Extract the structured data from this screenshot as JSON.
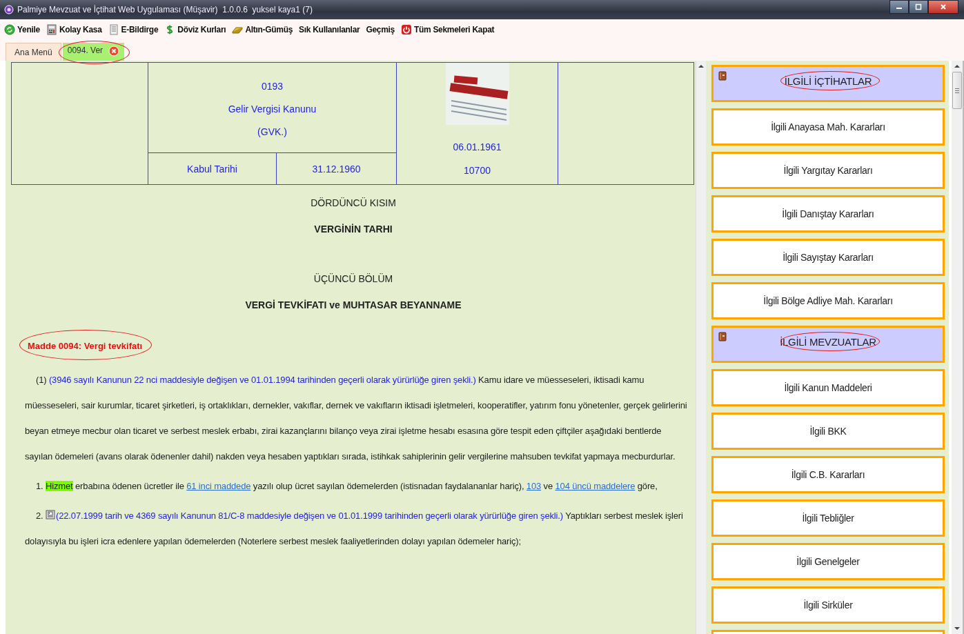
{
  "window": {
    "title": "Palmiye Mevzuat ve İçtihat Web Uygulaması (Müşavir)  1.0.0.6  yuksel kaya1 (7)"
  },
  "toolbar": [
    {
      "label": "Yenile"
    },
    {
      "label": "Kolay Kasa"
    },
    {
      "label": "E-Bildirge"
    },
    {
      "label": "Döviz Kurları"
    },
    {
      "label": "Altın-Gümüş"
    },
    {
      "label": "Sık Kullanılanlar"
    },
    {
      "label": "Geçmiş"
    },
    {
      "label": "Tüm Sekmeleri Kapat"
    }
  ],
  "tabs": [
    {
      "label": "Ana Menü",
      "selected": false,
      "closable": false,
      "circled": false
    },
    {
      "label": "0094. Ver",
      "selected": true,
      "closable": true,
      "circled": true
    }
  ],
  "law_header": {
    "number": "0193",
    "name": "Gelir Vergisi Kanunu",
    "abbreviation": "(GVK.)",
    "acceptance_label": "Kabul Tarihi",
    "acceptance_date": "31.12.1960",
    "gazette_date": "06.01.1961",
    "gazette_number": "10700"
  },
  "document": {
    "headings": [
      {
        "text": "DÖRDÜNCÜ KISIM",
        "bold": false
      },
      {
        "text": "VERGİNİN TARHI",
        "bold": true
      },
      {
        "text": "ÜÇÜNCÜ BÖLÜM",
        "bold": false
      },
      {
        "text": "VERGİ TEVKİFATI ve MUHTASAR BEYANNAME",
        "bold": true
      }
    ],
    "article_title": {
      "text": "Madde 0094: Vergi tevkifatı",
      "circled": true
    },
    "paragraphs": [
      {
        "segments": [
          {
            "kind": "text",
            "text": "(1) "
          },
          {
            "kind": "amendment",
            "text": "(3946 sayılı Kanunun 22 nci maddesiyle değişen ve 01.01.1994 tarihinden geçerli olarak yürürlüğe giren şekli.)"
          },
          {
            "kind": "text",
            "text": " Kamu idare ve müesseseleri, iktisadi kamu müesseseleri, sair kurumlar, ticaret şirketleri, iş ortaklıkları, dernekler, vakıflar, dernek ve vakıfların iktisadi işletmeleri, kooperatifler, yatırım fonu yönetenler, gerçek gelirlerini beyan etmeye mecbur olan ticaret ve serbest meslek erbabı, zirai kazançlarını bilanço veya zirai işletme hesabı esasına göre tespit eden çiftçiler aşağıdaki bentlerde sayılan ödemeleri (avans olarak ödenenler dahil) nakden veya hesaben yaptıkları sırada, istihkak sahiplerinin gelir vergilerine mahsuben tevkifat yapmaya mecburdurlar."
          }
        ]
      },
      {
        "segments": [
          {
            "kind": "text",
            "text": "1. "
          },
          {
            "kind": "highlight",
            "text": "Hizmet"
          },
          {
            "kind": "text",
            "text": " erbabına ödenen ücretler ile "
          },
          {
            "kind": "link",
            "text": "61 inci maddede"
          },
          {
            "kind": "text",
            "text": " yazılı olup ücret sayılan ödemelerden (istisnadan faydalananlar hariç), "
          },
          {
            "kind": "link",
            "text": "103"
          },
          {
            "kind": "text",
            "text": " ve "
          },
          {
            "kind": "link",
            "text": "104 üncü maddelere"
          },
          {
            "kind": "text",
            "text": " göre,"
          }
        ]
      },
      {
        "segments": [
          {
            "kind": "text",
            "text": "2. "
          },
          {
            "kind": "icon"
          },
          {
            "kind": "amendment",
            "text": "(22.07.1999 tarih ve 4369 sayılı Kanunun 81/C-8 maddesiyle değişen ve 01.01.1999 tarihinden geçerli olarak yürürlüğe giren şekli.)"
          },
          {
            "kind": "text",
            "text": " Yaptıkları serbest meslek işleri dolayısıyla bu işleri icra edenlere yapılan ödemelerden (Noterlere serbest meslek faaliyetlerinden dolayı yapılan ödemeler hariç);"
          }
        ]
      }
    ]
  },
  "side_panel": {
    "items": [
      {
        "kind": "header",
        "label": "İLGİLİ İÇTİHATLAR",
        "circled": true
      },
      {
        "kind": "link",
        "label": "İlgili Anayasa Mah. Kararları",
        "circled": false
      },
      {
        "kind": "link",
        "label": "İlgili Yargıtay Kararları",
        "circled": false
      },
      {
        "kind": "link",
        "label": "İlgili Danıştay Kararları",
        "circled": false
      },
      {
        "kind": "link",
        "label": "İlgili Sayıştay Kararları",
        "circled": false
      },
      {
        "kind": "link",
        "label": "İlgili Bölge Adliye Mah. Kararları",
        "circled": false
      },
      {
        "kind": "header",
        "label": "İLGİLİ MEVZUATLAR",
        "circled": true
      },
      {
        "kind": "link",
        "label": "İlgili Kanun Maddeleri",
        "circled": false
      },
      {
        "kind": "link",
        "label": "İlgili BKK",
        "circled": false
      },
      {
        "kind": "link",
        "label": "İlgili C.B. Kararları",
        "circled": false
      },
      {
        "kind": "link",
        "label": "İlgili Tebliğler",
        "circled": false
      },
      {
        "kind": "link",
        "label": "İlgili Genelgeler",
        "circled": false
      },
      {
        "kind": "link",
        "label": "İlgili Sirküler",
        "circled": false
      }
    ]
  }
}
